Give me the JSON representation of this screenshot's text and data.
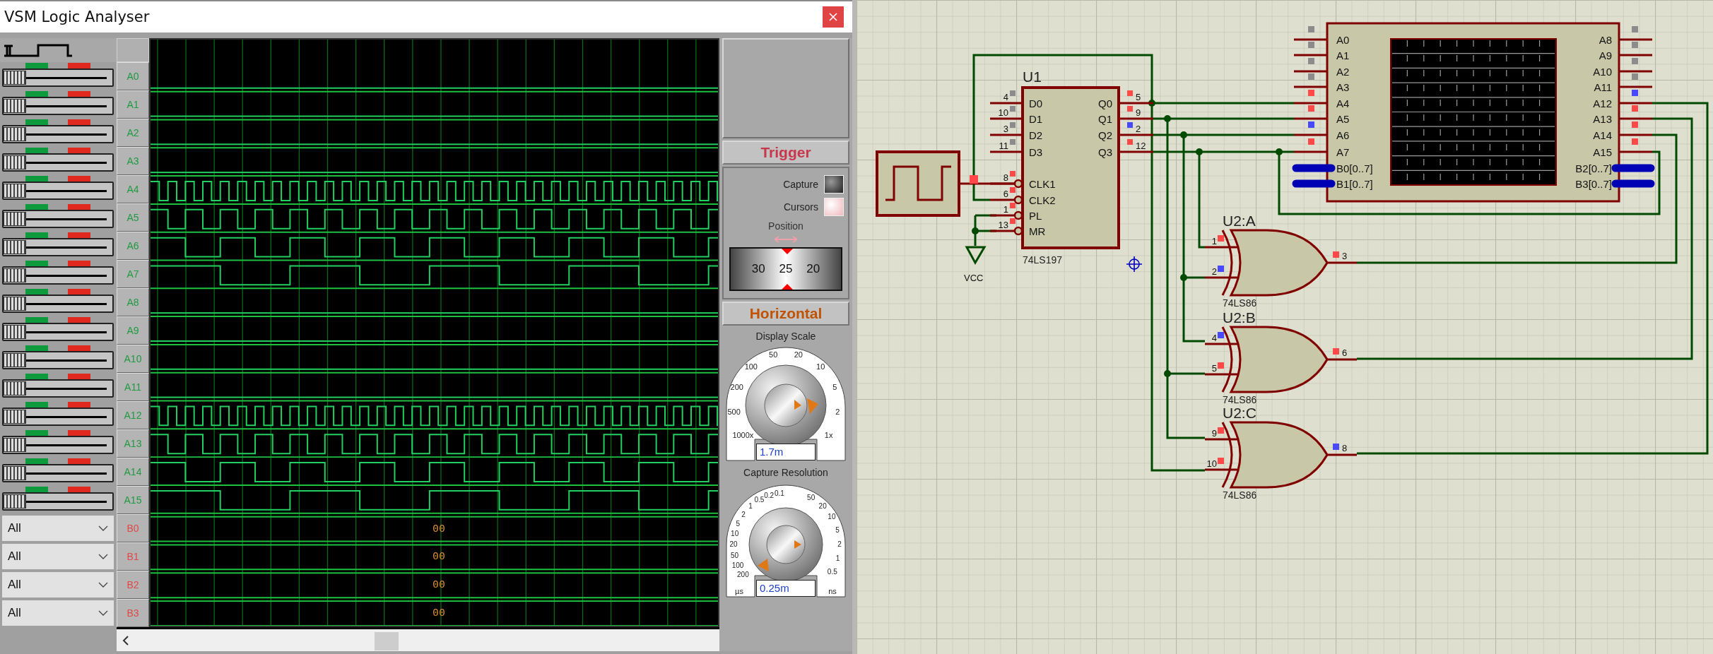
{
  "window": {
    "title": "VSM Logic Analyser"
  },
  "channels": [
    {
      "label": "A0",
      "kind": "bit",
      "active": false,
      "level": 0
    },
    {
      "label": "A1",
      "kind": "bit",
      "active": false,
      "level": 0
    },
    {
      "label": "A2",
      "kind": "bit",
      "active": false,
      "level": 0
    },
    {
      "label": "A3",
      "kind": "bit",
      "active": false,
      "level": 0
    },
    {
      "label": "A4",
      "kind": "bit",
      "active": true,
      "level": 0
    },
    {
      "label": "A5",
      "kind": "bit",
      "active": true,
      "level": 0
    },
    {
      "label": "A6",
      "kind": "bit",
      "active": true,
      "level": 0
    },
    {
      "label": "A7",
      "kind": "bit",
      "active": true,
      "level": 0
    },
    {
      "label": "A8",
      "kind": "bit",
      "active": false,
      "level": 0
    },
    {
      "label": "A9",
      "kind": "bit",
      "active": false,
      "level": 0
    },
    {
      "label": "A10",
      "kind": "bit",
      "active": false,
      "level": 0
    },
    {
      "label": "A11",
      "kind": "bit",
      "active": false,
      "level": 0
    },
    {
      "label": "A12",
      "kind": "bit",
      "active": true,
      "level": 0
    },
    {
      "label": "A13",
      "kind": "bit",
      "active": true,
      "level": 0
    },
    {
      "label": "A14",
      "kind": "bit",
      "active": true,
      "level": 0
    },
    {
      "label": "A15",
      "kind": "bit",
      "active": true,
      "level": 0
    },
    {
      "label": "B0",
      "kind": "bus",
      "filter": "All",
      "value": "00"
    },
    {
      "label": "B1",
      "kind": "bus",
      "filter": "All",
      "value": "00"
    },
    {
      "label": "B2",
      "kind": "bus",
      "filter": "All",
      "value": "00"
    },
    {
      "label": "B3",
      "kind": "bus",
      "filter": "All",
      "value": "00"
    }
  ],
  "trigger": {
    "title": "Trigger",
    "buttons": [
      {
        "label": "Capture",
        "on": false
      },
      {
        "label": "Cursors",
        "on": true
      }
    ],
    "position_label": "Position",
    "position_scale": [
      "30",
      "25",
      "20"
    ]
  },
  "horizontal": {
    "title": "Horizontal",
    "display_scale": {
      "label": "Display Scale",
      "ticks": [
        "1000x",
        "500",
        "200",
        "100",
        "50",
        "20",
        "10",
        "5",
        "2",
        "1x"
      ],
      "value": "1.7m"
    },
    "capture_resolution": {
      "label": "Capture Resolution",
      "ticks_us": [
        "0.1",
        "0.2",
        "0.5",
        "1",
        "2",
        "5",
        "10",
        "20",
        "50",
        "100",
        "200"
      ],
      "unit_us": "µs",
      "ticks_ns": [
        "50",
        "20",
        "10",
        "5",
        "2",
        "1",
        "0.5"
      ],
      "unit_ns": "ns",
      "value": "0.25m"
    }
  },
  "schematic": {
    "generator": {
      "color": "#ff4848"
    },
    "u1": {
      "ref": "U1",
      "part": "74LS197",
      "left_pins": [
        {
          "num": "4",
          "name": "D0",
          "color": "#8c8c8c"
        },
        {
          "num": "10",
          "name": "D1",
          "color": "#8c8c8c"
        },
        {
          "num": "3",
          "name": "D2",
          "color": "#8c8c8c"
        },
        {
          "num": "11",
          "name": "D3",
          "color": "#8c8c8c"
        },
        {
          "num": "8",
          "name": "CLK1",
          "color": "#ff4848"
        },
        {
          "num": "6",
          "name": "CLK2",
          "color": "#ff4848"
        },
        {
          "num": "1",
          "name": "PL",
          "color": "#ff4848"
        },
        {
          "num": "13",
          "name": "MR",
          "color": "#ff4848"
        }
      ],
      "right_pins": [
        {
          "num": "5",
          "name": "Q0",
          "color": "#ff4848"
        },
        {
          "num": "9",
          "name": "Q1",
          "color": "#ff4848"
        },
        {
          "num": "2",
          "name": "Q2",
          "color": "#4848ff"
        },
        {
          "num": "12",
          "name": "Q3",
          "color": "#ff4848"
        }
      ]
    },
    "vcc": {
      "label": "VCC"
    },
    "analyser": {
      "left_pins": [
        {
          "name": "A0",
          "kind": "bit",
          "color": "#8c8c8c"
        },
        {
          "name": "A1",
          "kind": "bit",
          "color": "#8c8c8c"
        },
        {
          "name": "A2",
          "kind": "bit",
          "color": "#8c8c8c"
        },
        {
          "name": "A3",
          "kind": "bit",
          "color": "#8c8c8c"
        },
        {
          "name": "A4",
          "kind": "bit",
          "color": "#ff4848"
        },
        {
          "name": "A5",
          "kind": "bit",
          "color": "#ff4848"
        },
        {
          "name": "A6",
          "kind": "bit",
          "color": "#4848ff"
        },
        {
          "name": "A7",
          "kind": "bit",
          "color": "#ff4848"
        },
        {
          "name": "B0[0..7]",
          "kind": "bus"
        },
        {
          "name": "B1[0..7]",
          "kind": "bus"
        }
      ],
      "right_pins": [
        {
          "name": "A8",
          "kind": "bit",
          "color": "#8c8c8c"
        },
        {
          "name": "A9",
          "kind": "bit",
          "color": "#8c8c8c"
        },
        {
          "name": "A10",
          "kind": "bit",
          "color": "#8c8c8c"
        },
        {
          "name": "A11",
          "kind": "bit",
          "color": "#8c8c8c"
        },
        {
          "name": "A12",
          "kind": "bit",
          "color": "#4848ff"
        },
        {
          "name": "A13",
          "kind": "bit",
          "color": "#ff4848"
        },
        {
          "name": "A14",
          "kind": "bit",
          "color": "#ff4848"
        },
        {
          "name": "A15",
          "kind": "bit",
          "color": "#ff4848"
        },
        {
          "name": "B2[0..7]",
          "kind": "bus"
        },
        {
          "name": "B3[0..7]",
          "kind": "bus"
        }
      ]
    },
    "gates": [
      {
        "ref": "U2:A",
        "part": "74LS86",
        "inputs": [
          {
            "num": "1",
            "color": "#ff4848"
          },
          {
            "num": "2",
            "color": "#4848ff"
          }
        ],
        "output": {
          "num": "3",
          "color": "#ff4848"
        }
      },
      {
        "ref": "U2:B",
        "part": "74LS86",
        "inputs": [
          {
            "num": "4",
            "color": "#4848ff"
          },
          {
            "num": "5",
            "color": "#ff4848"
          }
        ],
        "output": {
          "num": "6",
          "color": "#ff4848"
        }
      },
      {
        "ref": "U2:C",
        "part": "74LS86",
        "inputs": [
          {
            "num": "9",
            "color": "#ff4848"
          },
          {
            "num": "10",
            "color": "#ff4848"
          }
        ],
        "output": {
          "num": "8",
          "color": "#4848ff"
        }
      }
    ]
  }
}
